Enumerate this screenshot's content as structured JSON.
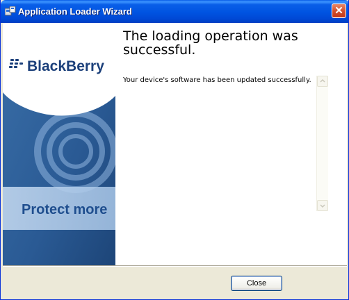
{
  "window": {
    "title": "Application Loader Wizard",
    "icon": "application-loader-icon",
    "close_glyph": "✕"
  },
  "banner": {
    "brand": "BlackBerry",
    "tagline": "Protect more"
  },
  "content": {
    "heading": "The loading operation was successful.",
    "message": "Your device's software has been updated successfully."
  },
  "footer": {
    "close_label": "Close"
  },
  "colors": {
    "titlebar": "#0053e1",
    "banner_blue": "#234f86",
    "button_border": "#003c74"
  }
}
